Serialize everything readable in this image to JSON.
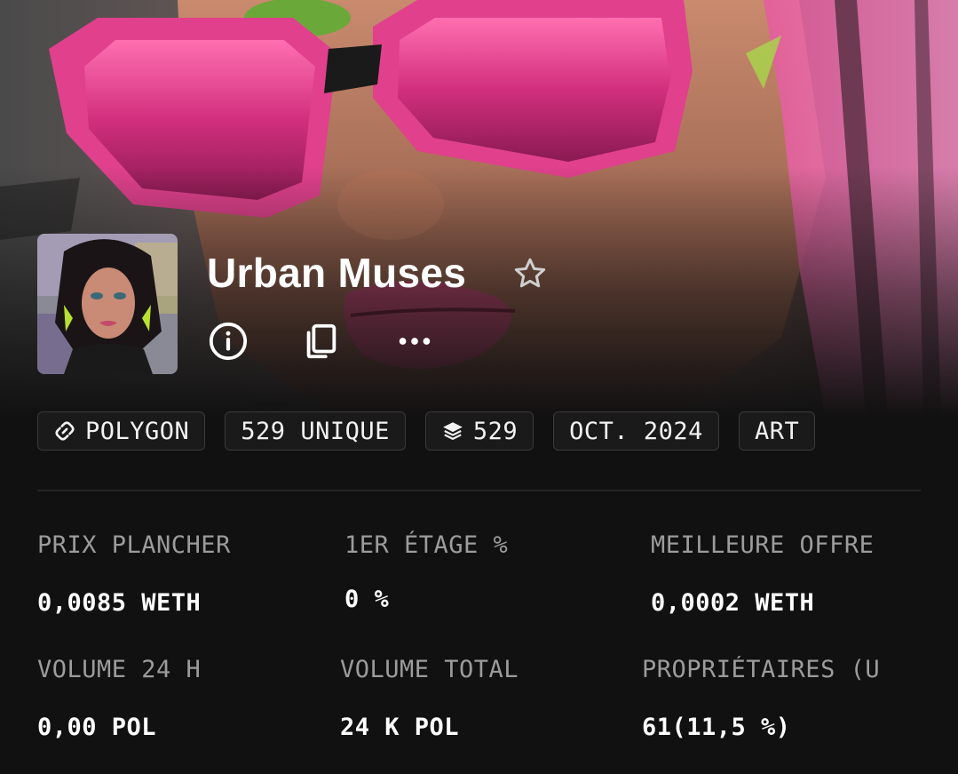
{
  "collection": {
    "name": "Urban Muses",
    "icons": {
      "favorite": "star-outline-icon",
      "info": "info-circle-icon",
      "copy": "copy-icon",
      "more": "more-horizontal-icon"
    }
  },
  "chips": [
    {
      "label": "POLYGON",
      "icon": "link-icon"
    },
    {
      "label": "529 UNIQUE"
    },
    {
      "label": "529",
      "icon": "layers-icon"
    },
    {
      "label": "OCT. 2024"
    },
    {
      "label": "ART"
    }
  ],
  "stats": {
    "floor_price": {
      "label": "PRIX PLANCHER",
      "value": "0,0085 WETH"
    },
    "first_sale": {
      "label": "1ER ÉTAGE %",
      "value": "0 %"
    },
    "best_offer": {
      "label": "MEILLEURE OFFRE",
      "value": "0,0002 WETH"
    },
    "volume_24h": {
      "label": "VOLUME 24 H",
      "value": "0,00 POL"
    },
    "volume_total": {
      "label": "VOLUME TOTAL",
      "value": "24 K POL"
    },
    "owners": {
      "label": "PROPRIÉTAIRES (U",
      "value": "61(11,5 %)"
    }
  },
  "colors": {
    "background": "#111111",
    "accent_pink": "#e8418f",
    "muted_text": "#9c9c9c",
    "chip_border": "#3a3a3a"
  }
}
